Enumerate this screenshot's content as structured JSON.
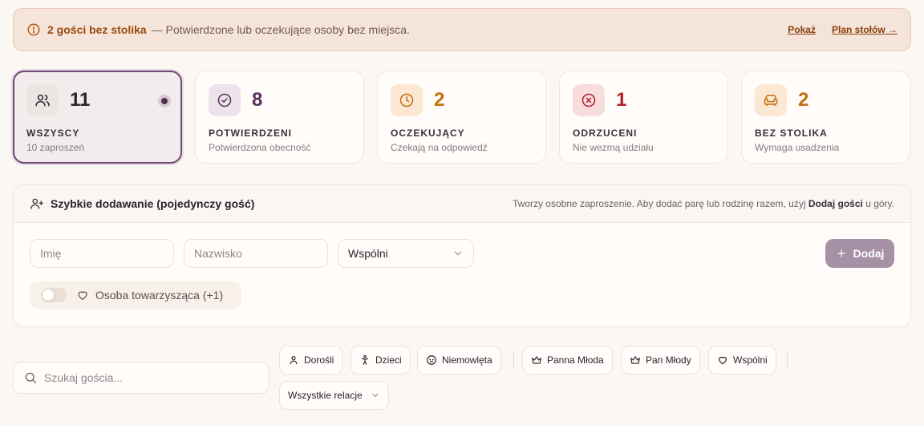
{
  "alert": {
    "title": "2 gości bez stolika",
    "description": "— Potwierdzone lub oczekujące osoby bez miejsca.",
    "show_link": "Pokaż",
    "separator": "·",
    "plan_link": "Plan stołów →"
  },
  "stats": [
    {
      "number": "11",
      "label": "WSZYSCY",
      "sub": "10 zaproszeń",
      "icon": "users-icon",
      "color": "#2b2230",
      "bg": "#ece6e2"
    },
    {
      "number": "8",
      "label": "POTWIERDZENI",
      "sub": "Potwierdzona obecność",
      "icon": "check-circle-icon",
      "color": "#5a2f5e",
      "bg": "#ece4ea"
    },
    {
      "number": "2",
      "label": "OCZEKUJĄCY",
      "sub": "Czekają na odpowiedź",
      "icon": "clock-icon",
      "color": "#c26f12",
      "bg": "#fbe7d2"
    },
    {
      "number": "1",
      "label": "ODRZUCENI",
      "sub": "Nie wezmą udziału",
      "icon": "x-circle-icon",
      "color": "#b3202a",
      "bg": "#f8dddd"
    },
    {
      "number": "2",
      "label": "BEZ STOLIKA",
      "sub": "Wymaga usadzenia",
      "icon": "sofa-icon",
      "color": "#c26f12",
      "bg": "#fbe7d2"
    }
  ],
  "quick_add": {
    "title": "Szybkie dodawanie (pojedynczy gość)",
    "hint_prefix": "Tworzy osobne zaproszenie. Aby dodać parę lub rodzinę razem, użyj",
    "hint_bold": "Dodaj gości",
    "hint_suffix": "u góry.",
    "first_name_placeholder": "Imię",
    "last_name_placeholder": "Nazwisko",
    "relation_value": "Wspólni",
    "add_label": "Dodaj",
    "companion_label": "Osoba towarzysząca (+1)"
  },
  "search": {
    "placeholder": "Szukaj gościa..."
  },
  "filters": {
    "adults": "Dorośli",
    "children": "Dzieci",
    "infants": "Niemowlęta",
    "bride": "Panna Młoda",
    "groom": "Pan Młody",
    "shared": "Wspólni",
    "all_relations": "Wszystkie relacje"
  }
}
